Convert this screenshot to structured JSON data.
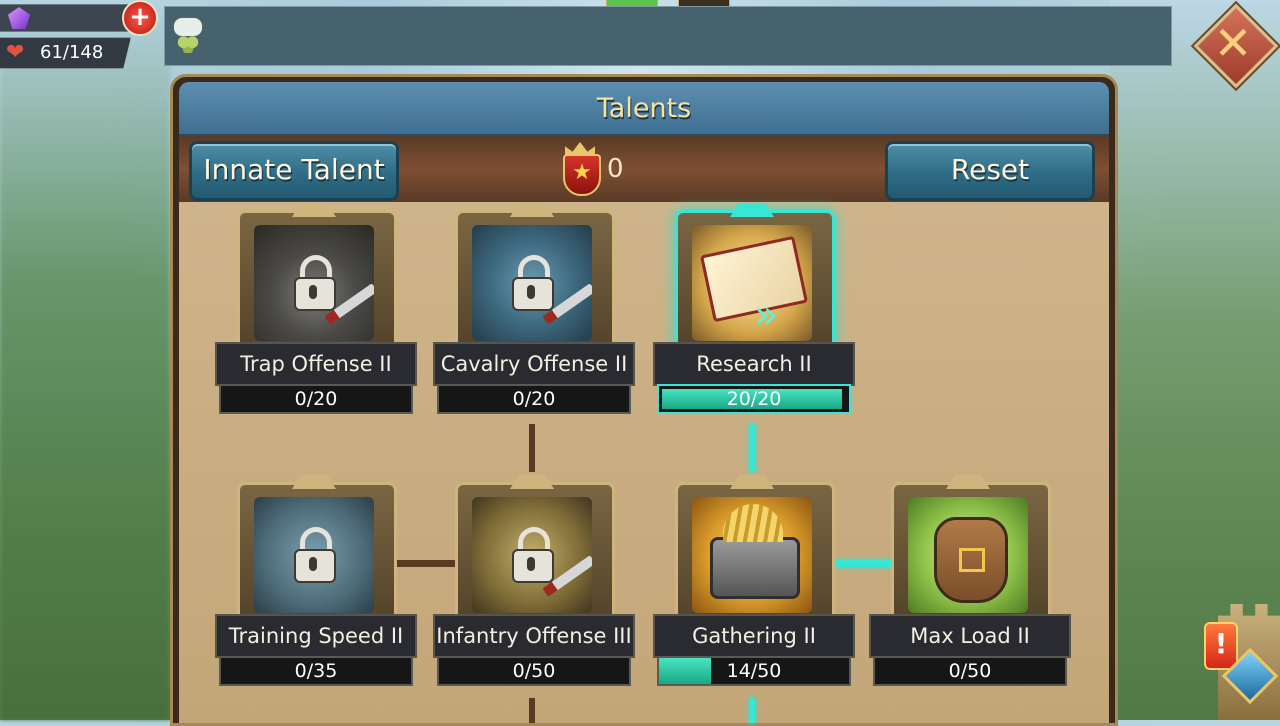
{
  "status": {
    "gems_value": "",
    "health": "61/148"
  },
  "panel": {
    "title": "Talents",
    "innate_button": "Innate Talent",
    "reset_button": "Reset",
    "talent_points": "0"
  },
  "talents": [
    {
      "name": "Trap Offense II",
      "progress": "0/20",
      "fill": 0.0,
      "locked": true,
      "icon": "trap-icon"
    },
    {
      "name": "Cavalry Offense II",
      "progress": "0/20",
      "fill": 0.0,
      "locked": true,
      "icon": "cavalry-icon"
    },
    {
      "name": "Research II",
      "progress": "20/20",
      "fill": 1.0,
      "locked": false,
      "icon": "research-book-icon"
    },
    {
      "name": "Training Speed II",
      "progress": "0/35",
      "fill": 0.0,
      "locked": true,
      "icon": "training-dummy-icon"
    },
    {
      "name": "Infantry Offense III",
      "progress": "0/50",
      "fill": 0.0,
      "locked": true,
      "icon": "infantry-icon"
    },
    {
      "name": "Gathering II",
      "progress": "14/50",
      "fill": 0.28,
      "locked": false,
      "icon": "gathering-cart-icon"
    },
    {
      "name": "Max Load II",
      "progress": "0/50",
      "fill": 0.0,
      "locked": false,
      "icon": "backpack-icon"
    }
  ],
  "colors": {
    "accent_cyan": "#37e6d5",
    "button_teal": "#2f6c85",
    "title_gold": "#f6e3a2"
  }
}
